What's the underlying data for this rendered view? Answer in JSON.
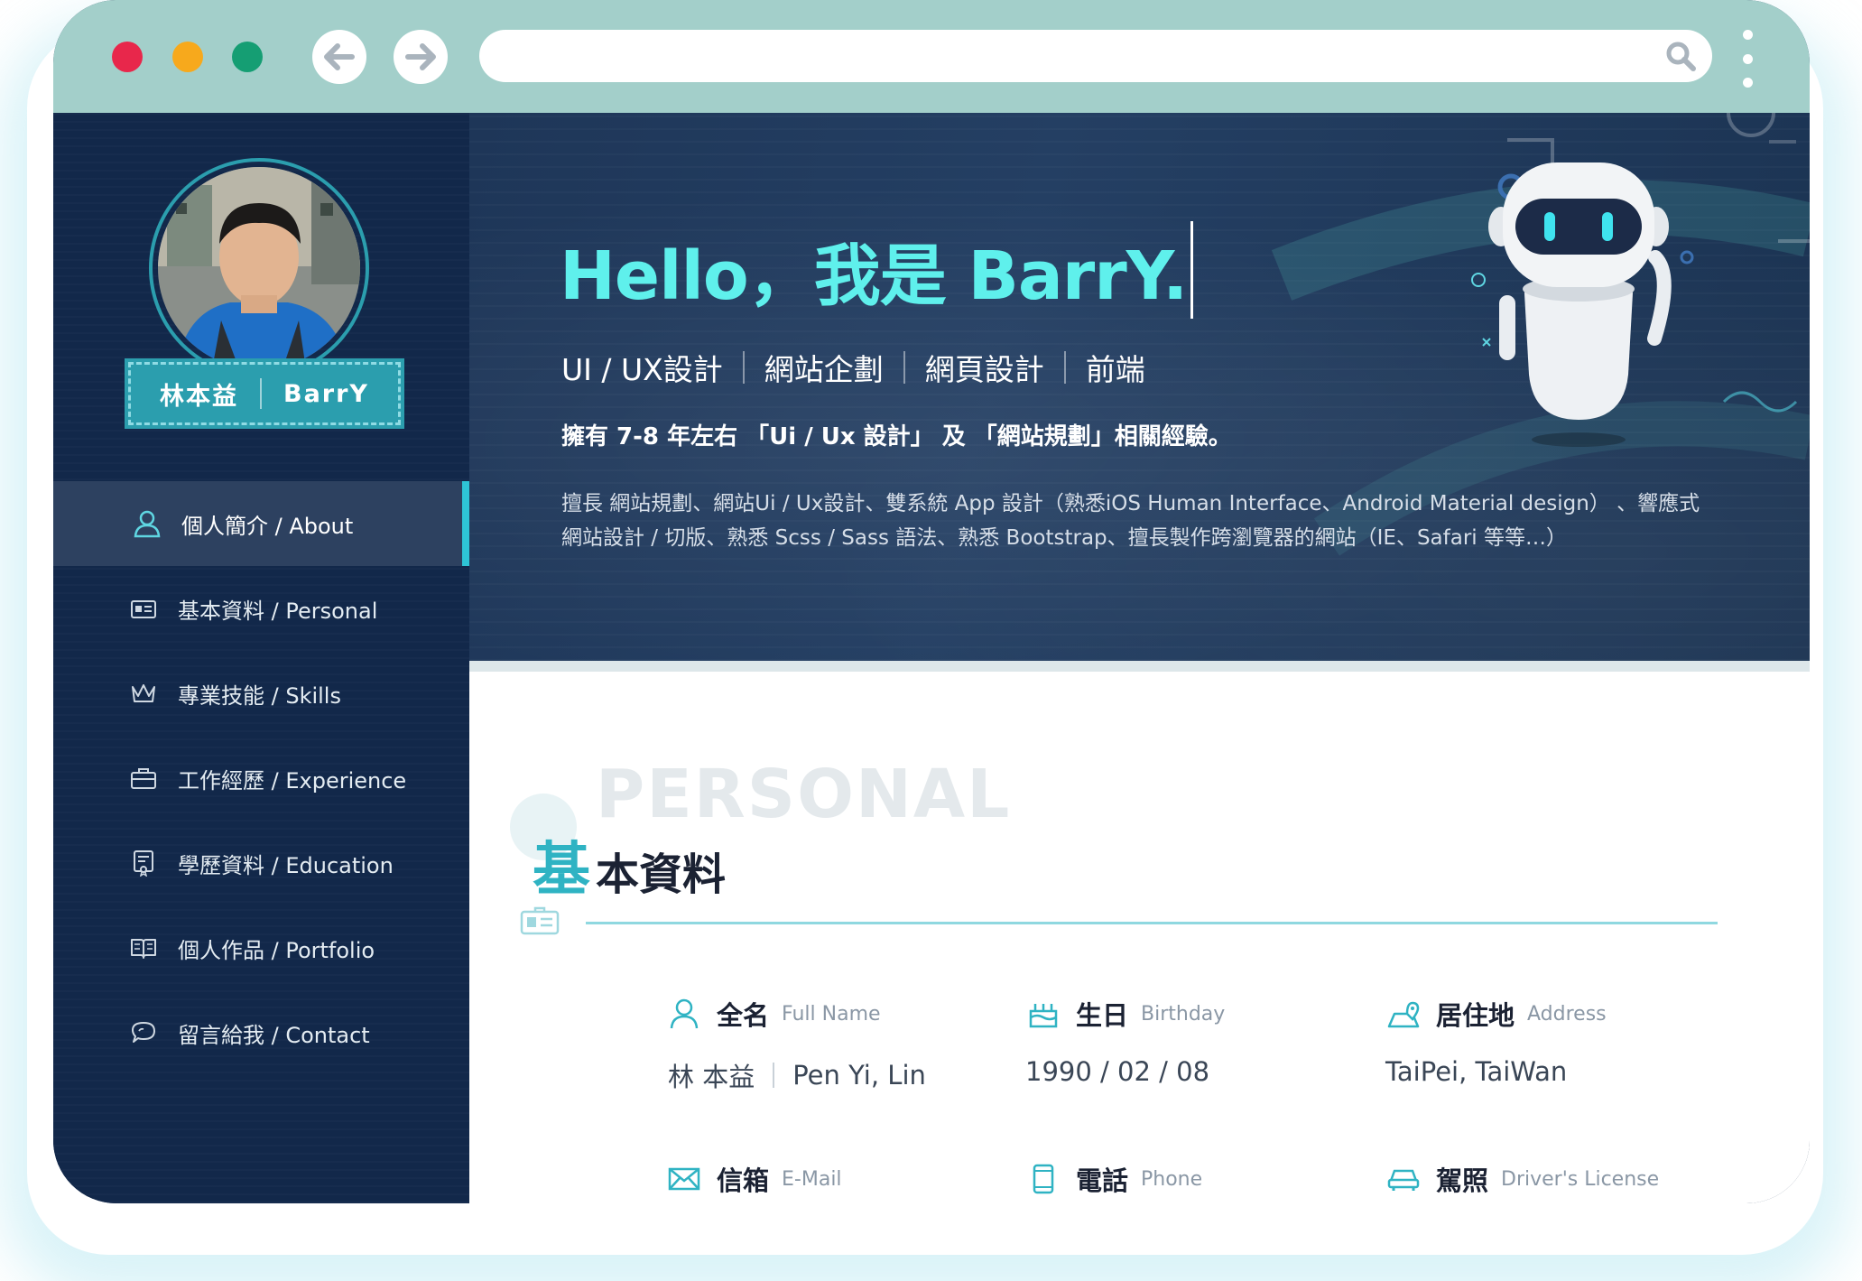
{
  "colors": {
    "chrome": "#a3cfca",
    "sidebar": "#12284a",
    "accent": "#2ec4d6",
    "hero_title": "#5ff0ec"
  },
  "profile": {
    "name_zh": "林本益",
    "name_en": "BarrY"
  },
  "menu": [
    {
      "label": "個人簡介 / About",
      "icon": "user-icon",
      "active": true
    },
    {
      "label": "基本資料 / Personal",
      "icon": "id-card-icon",
      "active": false
    },
    {
      "label": "專業技能 / Skills",
      "icon": "crown-icon",
      "active": false
    },
    {
      "label": "工作經歷 / Experience",
      "icon": "briefcase-icon",
      "active": false
    },
    {
      "label": "學歷資料 / Education",
      "icon": "certificate-icon",
      "active": false
    },
    {
      "label": "個人作品 / Portfolio",
      "icon": "book-icon",
      "active": false
    },
    {
      "label": "留言給我 / Contact",
      "icon": "chat-icon",
      "active": false
    }
  ],
  "hero": {
    "title": "Hello，我是 BarrY.",
    "roles": [
      "UI / UX設計",
      "網站企劃",
      "網頁設計",
      "前端"
    ],
    "experience": "擁有 7-8 年左右 「Ui / Ux 設計」 及 「網站規劃」相關經驗。",
    "description": "擅長 網站規劃、網站Ui / Ux設計、雙系統 App 設計（熟悉iOS Human Interface、Android Material design） 、響應式網站設計 / 切版、熟悉 Scss / Sass 語法、熟悉 Bootstrap、擅長製作跨瀏覽器的網站（IE、Safari 等等…）"
  },
  "section": {
    "ghost": "PERSONAL",
    "title_first": "基",
    "title_rest": "本資料"
  },
  "fields": {
    "fullname": {
      "zh": "全名",
      "en": "Full Name",
      "value_zh": "林 本益",
      "value_en": "Pen Yi, Lin"
    },
    "birthday": {
      "zh": "生日",
      "en": "Birthday",
      "value": "1990 / 02 / 08"
    },
    "address": {
      "zh": "居住地",
      "en": "Address",
      "value": "TaiPei, TaiWan"
    },
    "email": {
      "zh": "信箱",
      "en": "E-Mail"
    },
    "phone": {
      "zh": "電話",
      "en": "Phone"
    },
    "license": {
      "zh": "駕照",
      "en": "Driver's License"
    }
  }
}
